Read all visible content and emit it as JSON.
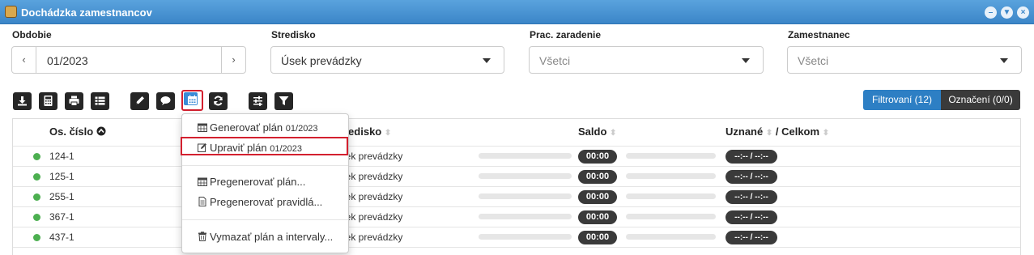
{
  "window": {
    "title": "Dochádzka zamestnancov",
    "controls": [
      "–",
      "▼",
      "×"
    ]
  },
  "filters": {
    "period_label": "Obdobie",
    "period_value": "01/2023",
    "period_prev": "‹",
    "period_next": "›",
    "stredisko_label": "Stredisko",
    "stredisko_value": "Úsek prevádzky",
    "zaradenie_label": "Prac. zaradenie",
    "zaradenie_value": "Všetci",
    "zamestnanec_label": "Zamestnanec",
    "zamestnanec_value": "Všetci"
  },
  "toolbar": {
    "icons": [
      "download-icon",
      "calculator-icon",
      "print-icon",
      "list-icon",
      "pencil-icon",
      "comment-icon",
      "calendar-icon",
      "refresh-icon",
      "sliders-icon",
      "filter-icon"
    ],
    "filtered_label": "Filtrovaní (12)",
    "selected_label": "Označení (0/0)"
  },
  "table": {
    "headers": {
      "os_cislo": "Os. číslo",
      "stredisko": "Stredisko",
      "saldo": "Saldo",
      "uznane": "Uznané",
      "celkom": "/ Celkom"
    },
    "rows": [
      {
        "os_cislo": "124-1",
        "stredisko": "Úsek prevádzky",
        "saldo": "00:00",
        "uznane": "--:-- / --:--"
      },
      {
        "os_cislo": "125-1",
        "stredisko": "Úsek prevádzky",
        "saldo": "00:00",
        "uznane": "--:-- / --:--"
      },
      {
        "os_cislo": "255-1",
        "stredisko": "Úsek prevádzky",
        "saldo": "00:00",
        "uznane": "--:-- / --:--"
      },
      {
        "os_cislo": "367-1",
        "stredisko": "Úsek prevádzky",
        "saldo": "00:00",
        "uznane": "--:-- / --:--"
      },
      {
        "os_cislo": "437-1",
        "stredisko": "Úsek prevádzky",
        "saldo": "00:00",
        "uznane": "--:-- / --:--"
      }
    ]
  },
  "menu": {
    "generate": "Generovať plán",
    "generate_period": "01/2023",
    "edit": "Upraviť plán",
    "edit_period": "01/2023",
    "regenerate_plan": "Pregenerovať plán...",
    "regenerate_rules": "Pregenerovať pravidlá...",
    "delete": "Vymazať plán a intervaly..."
  },
  "colors": {
    "titlebar": "#3b86c8",
    "accent": "#2d7fc4",
    "highlight": "#d3202f",
    "status_ok": "#4caf50"
  }
}
